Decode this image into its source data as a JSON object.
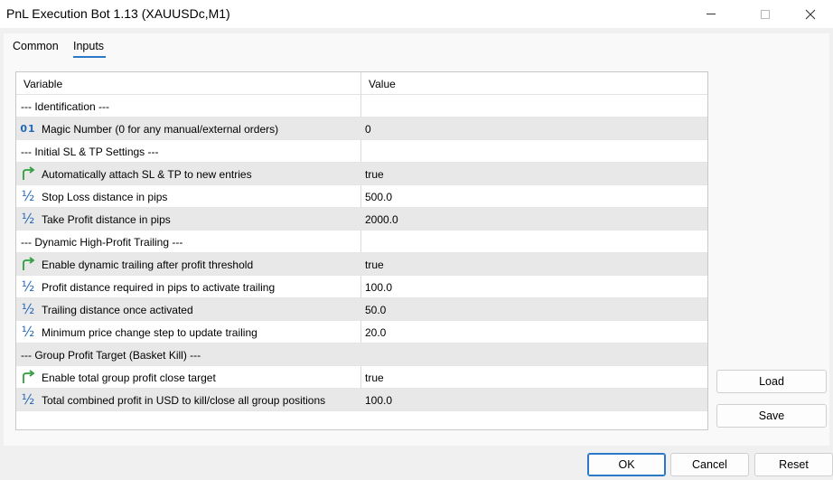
{
  "window": {
    "title": "PnL Execution Bot 1.13 (XAUUSDc,M1)"
  },
  "tabs": [
    {
      "label": "Common",
      "active": false
    },
    {
      "label": "Inputs",
      "active": true
    }
  ],
  "grid": {
    "columns": {
      "variable": "Variable",
      "value": "Value"
    },
    "rows": [
      {
        "kind": "section",
        "label": "--- Identification ---",
        "value": ""
      },
      {
        "kind": "int",
        "icon": "integer-icon",
        "label": "Magic Number (0 for any manual/external orders)",
        "value": "0"
      },
      {
        "kind": "section",
        "label": "--- Initial SL & TP Settings ---",
        "value": ""
      },
      {
        "kind": "bool",
        "icon": "boolean-arrow-icon",
        "label": "Automatically attach SL & TP to new entries",
        "value": "true"
      },
      {
        "kind": "double",
        "icon": "fraction-icon",
        "label": "Stop Loss distance in pips",
        "value": "500.0"
      },
      {
        "kind": "double",
        "icon": "fraction-icon",
        "label": "Take Profit distance in pips",
        "value": "2000.0"
      },
      {
        "kind": "section",
        "label": "--- Dynamic High-Profit Trailing ---",
        "value": ""
      },
      {
        "kind": "bool",
        "icon": "boolean-arrow-icon",
        "label": "Enable dynamic trailing after profit threshold",
        "value": "true"
      },
      {
        "kind": "double",
        "icon": "fraction-icon",
        "label": "Profit distance required in pips to activate trailing",
        "value": "100.0"
      },
      {
        "kind": "double",
        "icon": "fraction-icon",
        "label": "Trailing distance once activated",
        "value": "50.0"
      },
      {
        "kind": "double",
        "icon": "fraction-icon",
        "label": "Minimum price change step to update trailing",
        "value": "20.0"
      },
      {
        "kind": "section",
        "label": "--- Group Profit Target (Basket Kill) ---",
        "value": ""
      },
      {
        "kind": "bool",
        "icon": "boolean-arrow-icon",
        "label": "Enable total group profit close target",
        "value": "true"
      },
      {
        "kind": "double",
        "icon": "fraction-icon",
        "label": "Total combined profit in USD to kill/close all group positions",
        "value": "100.0"
      }
    ]
  },
  "side_buttons": {
    "load": "Load",
    "save": "Save"
  },
  "footer": {
    "ok": "OK",
    "cancel": "Cancel",
    "reset": "Reset"
  },
  "colors": {
    "accent": "#2b79c8",
    "icon_blue": "#2468b8",
    "icon_green": "#2f9e3c",
    "row_alt": "#e8e8e8"
  }
}
